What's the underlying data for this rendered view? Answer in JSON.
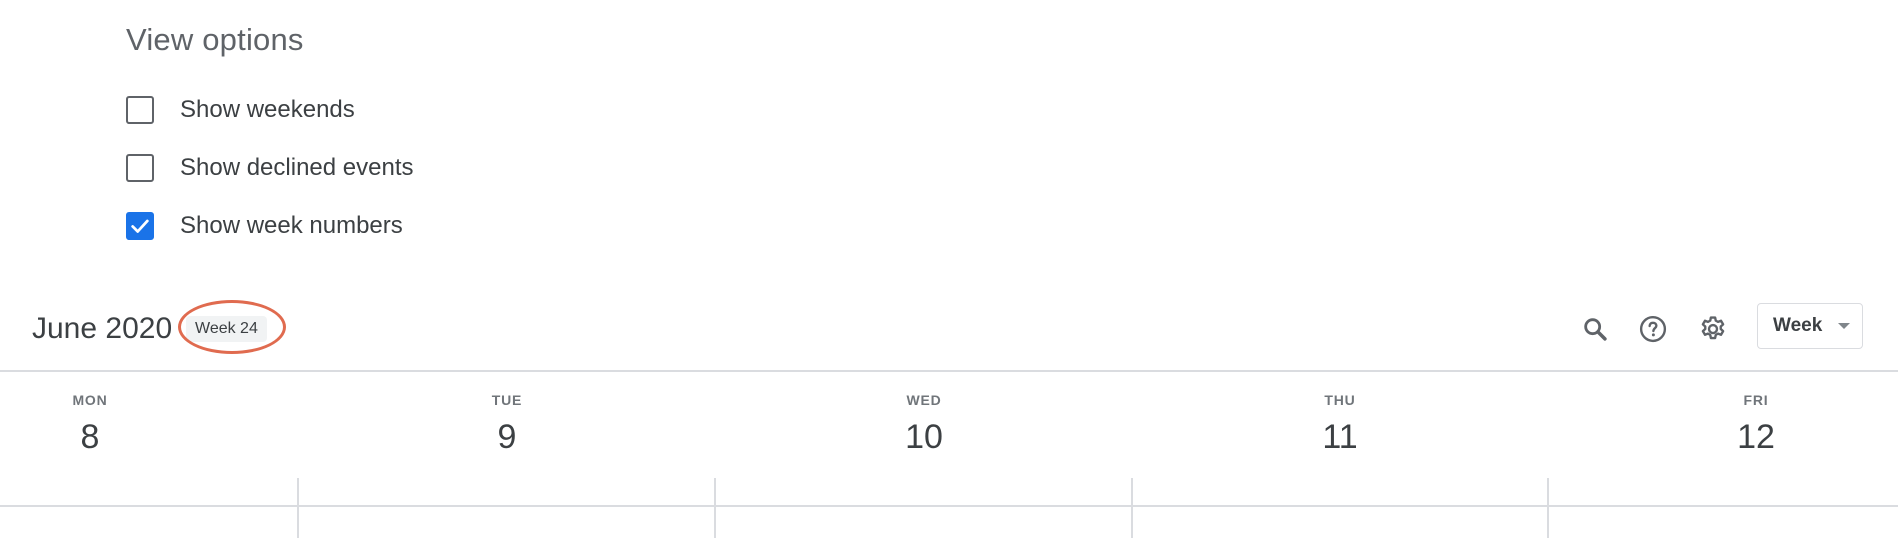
{
  "view_options": {
    "title": "View options",
    "options": [
      {
        "label": "Show weekends",
        "checked": false
      },
      {
        "label": "Show declined events",
        "checked": false
      },
      {
        "label": "Show week numbers",
        "checked": true
      }
    ]
  },
  "header": {
    "month_title": "June 2020",
    "week_chip": "Week 24",
    "icons": [
      "search-icon",
      "help-icon",
      "settings-icon"
    ],
    "view_select": {
      "value": "Week"
    }
  },
  "days": [
    {
      "name": "MON",
      "number": "8"
    },
    {
      "name": "TUE",
      "number": "9"
    },
    {
      "name": "WED",
      "number": "10"
    },
    {
      "name": "THU",
      "number": "11"
    },
    {
      "name": "FRI",
      "number": "12"
    }
  ],
  "colors": {
    "accent": "#1a73e8",
    "highlight_ring": "#e06b4f",
    "divider": "#dadce0",
    "text": "#3c4043",
    "muted": "#5f6368"
  }
}
